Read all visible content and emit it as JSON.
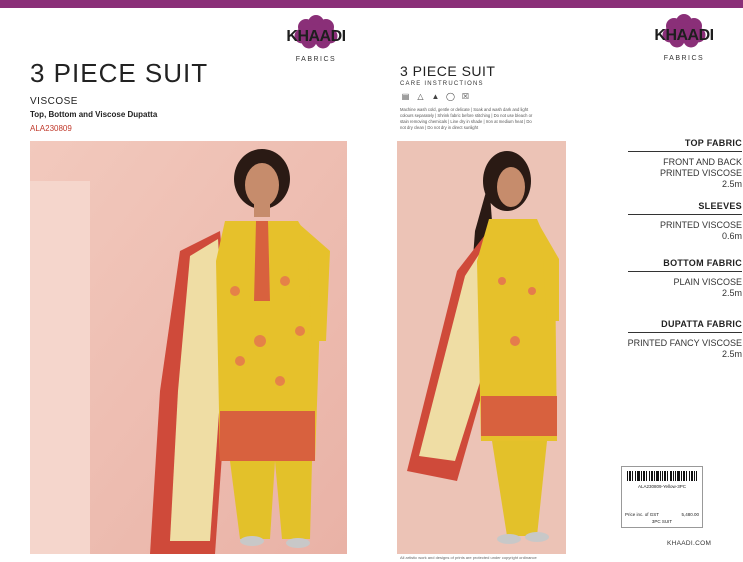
{
  "brand": {
    "name": "KHAADI",
    "tagline": "FABRICS",
    "accent": "#8a2f78"
  },
  "left_panel": {
    "title": "3 PIECE SUIT",
    "fabric": "VISCOSE",
    "subtitle": "Top, Bottom and Viscose  Dupatta",
    "code": "ALA230809"
  },
  "middle_panel": {
    "title": "3 PIECE SUIT",
    "care_heading": "CARE INSTRUCTIONS",
    "care_icons": [
      "wash-icon",
      "no-bleach-icon",
      "iron-icon",
      "no-dry-clean-icon",
      "no-tumble-dry-icon"
    ],
    "care_text": "Machine wash cold, gentle or delicate | Soak and wash dark and light colours separately | Shrink fabric before stitching | Do not use bleach or stain removing chemicals | Line dry in shade | Iron at medium heat | Do not dry clean | Do not dry in direct sunlight",
    "footer": "All artistic work and designs of prints are protected under copyright ordinance"
  },
  "specs": [
    {
      "heading": "TOP FABRIC",
      "desc1": "FRONT AND BACK",
      "desc2": "PRINTED VISCOSE",
      "amount": "2.5m"
    },
    {
      "heading": "SLEEVES",
      "desc1": "PRINTED VISCOSE",
      "desc2": "",
      "amount": "0.6m"
    },
    {
      "heading": "BOTTOM FABRIC",
      "desc1": "PLAIN VISCOSE",
      "desc2": "",
      "amount": "2.5m"
    },
    {
      "heading": "DUPATTA FABRIC",
      "desc1": "PRINTED FANCY VISCOSE",
      "desc2": "",
      "amount": "2.5m"
    }
  ],
  "label": {
    "sku": "ALA230809-Yellow-3PC",
    "price_label": "Price inc. of GST",
    "price": "5,480.00",
    "type": "3PC SUIT"
  },
  "website": "KHAADI.COM"
}
